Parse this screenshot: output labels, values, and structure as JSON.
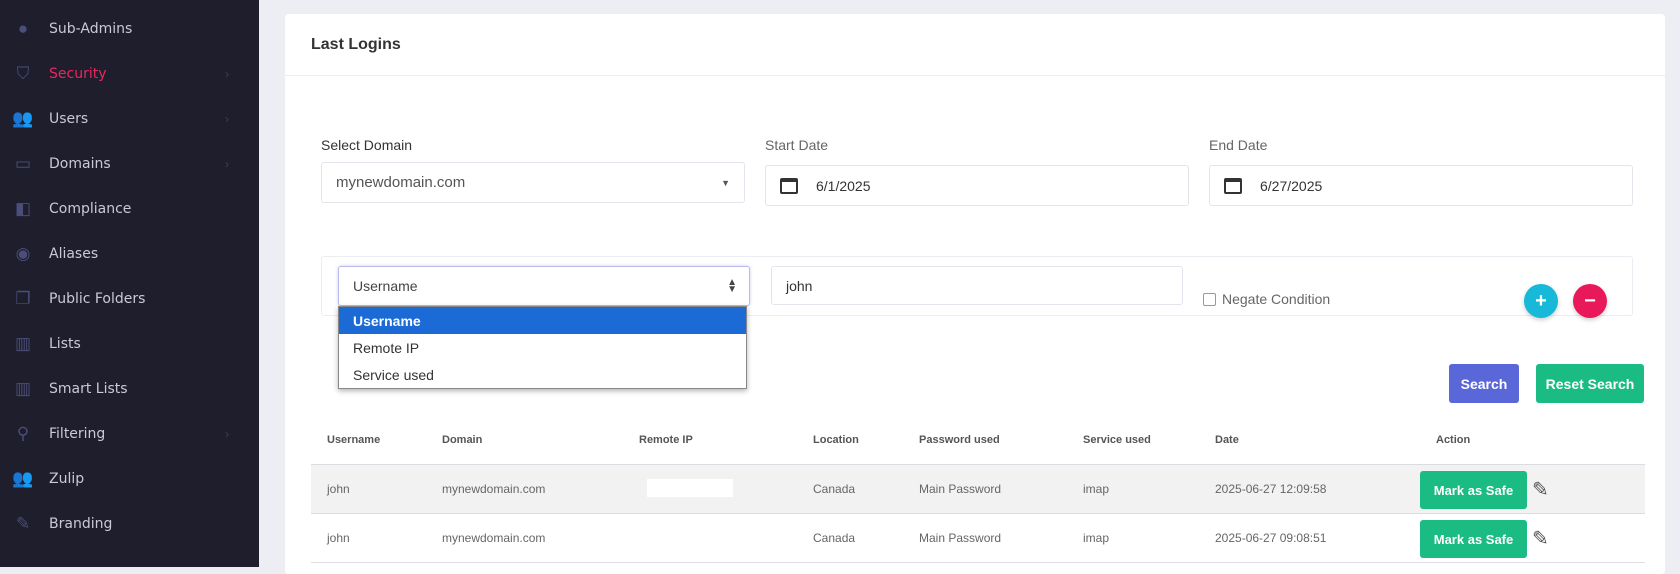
{
  "sidebar": {
    "items": [
      {
        "label": "Sub-Admins",
        "icon": "user-icon",
        "chevron": false
      },
      {
        "label": "Security",
        "icon": "shield-icon",
        "chevron": true,
        "active": true
      },
      {
        "label": "Users",
        "icon": "users-icon",
        "chevron": true
      },
      {
        "label": "Domains",
        "icon": "window-icon",
        "chevron": true
      },
      {
        "label": "Compliance",
        "icon": "compliance-icon",
        "chevron": false
      },
      {
        "label": "Aliases",
        "icon": "aliases-icon",
        "chevron": false
      },
      {
        "label": "Public Folders",
        "icon": "folders-icon",
        "chevron": false
      },
      {
        "label": "Lists",
        "icon": "book-icon",
        "chevron": false
      },
      {
        "label": "Smart Lists",
        "icon": "book-icon",
        "chevron": false
      },
      {
        "label": "Filtering",
        "icon": "search-icon",
        "chevron": true
      },
      {
        "label": "Zulip",
        "icon": "users-icon",
        "chevron": false
      },
      {
        "label": "Branding",
        "icon": "brush-icon",
        "chevron": false
      }
    ]
  },
  "card": {
    "title": "Last Logins"
  },
  "form": {
    "domain_label": "Select Domain",
    "domain_value": "mynewdomain.com",
    "start_label": "Start Date",
    "start_value": "6/1/2025",
    "end_label": "End Date",
    "end_value": "6/27/2025"
  },
  "filter": {
    "field_value": "Username",
    "options": [
      "Username",
      "Remote IP",
      "Service used"
    ],
    "text_value": "john",
    "negate_label": "Negate Condition",
    "add": "+",
    "remove": "−"
  },
  "buttons": {
    "search": "Search",
    "reset": "Reset Search"
  },
  "colors": {
    "search": "#5a67d8",
    "green": "#1abc84",
    "cyan": "#17b8d8",
    "pink": "#e8185a"
  },
  "table": {
    "headers": [
      "Username",
      "Domain",
      "Remote IP",
      "Location",
      "Password used",
      "Service used",
      "Date",
      "Action"
    ],
    "rows": [
      {
        "username": "john",
        "domain": "mynewdomain.com",
        "ip": "",
        "location": "Canada",
        "password": "Main Password",
        "service": "imap",
        "date": "2025-06-27 12:09:58",
        "action": "Mark as Safe"
      },
      {
        "username": "john",
        "domain": "mynewdomain.com",
        "ip": "",
        "location": "Canada",
        "password": "Main Password",
        "service": "imap",
        "date": "2025-06-27 09:08:51",
        "action": "Mark as Safe"
      }
    ]
  }
}
